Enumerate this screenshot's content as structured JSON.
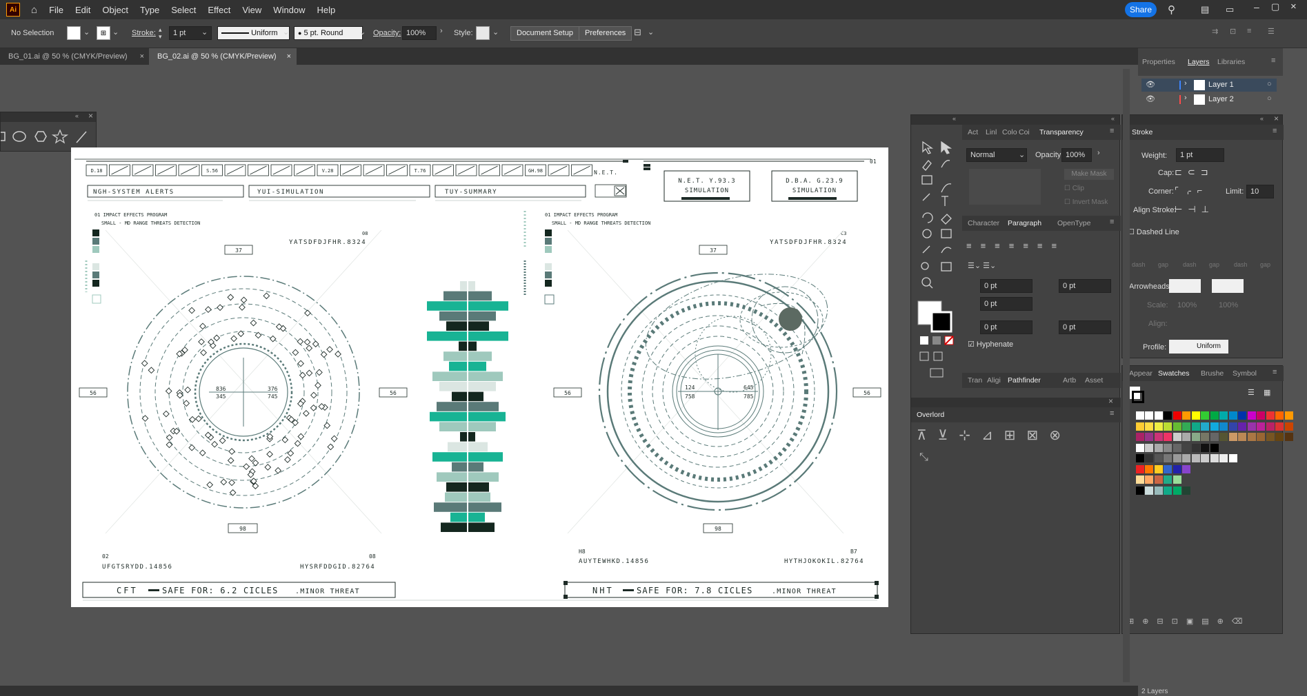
{
  "app": {
    "logo": "Ai"
  },
  "menu": [
    "File",
    "Edit",
    "Object",
    "Type",
    "Select",
    "Effect",
    "View",
    "Window",
    "Help"
  ],
  "share_label": "Share",
  "control": {
    "selection": "No Selection",
    "stroke_label": "Stroke:",
    "stroke_value": "1 pt",
    "uniform": "Uniform",
    "brush": "5 pt. Round",
    "opacity_label": "Opacity:",
    "opacity_value": "100%",
    "style_label": "Style:",
    "doc_setup": "Document Setup",
    "preferences": "Preferences"
  },
  "tabs": [
    {
      "label": "BG_01.ai @ 50 % (CMYK/Preview)",
      "close": "×"
    },
    {
      "label": "BG_02.ai @ 50 % (CMYK/Preview)",
      "close": "×"
    }
  ],
  "layers_panel": {
    "tabs": [
      "Properties",
      "Layers",
      "Libraries"
    ],
    "layers": [
      "Layer 1",
      "Layer 2"
    ],
    "footer": "2 Layers"
  },
  "transparency_panel": {
    "tabs": [
      "Act",
      "Linl",
      "Colo",
      "Coi",
      "Transparency"
    ],
    "mode": "Normal",
    "opacity_label": "Opacity:",
    "opacity_value": "100%",
    "make_mask": "Make Mask",
    "clip": "Clip",
    "invert": "Invert Mask"
  },
  "paragraph_panel": {
    "tabs": [
      "Character",
      "Paragraph",
      "OpenType"
    ],
    "fields": [
      "0 pt",
      "0 pt",
      "0 pt",
      "0 pt",
      "0 pt"
    ],
    "hyphenate": "Hyphenate"
  },
  "pathfinder_row": [
    "Tran",
    "Aligi",
    "Pathfinder",
    "Artb",
    "Asset"
  ],
  "overlord": {
    "title": "Overlord"
  },
  "stroke_panel": {
    "title": "Stroke",
    "weight_label": "Weight:",
    "weight_value": "1 pt",
    "cap_label": "Cap:",
    "corner_label": "Corner:",
    "limit_label": "Limit:",
    "limit_value": "10",
    "align_label": "Align Stroke:",
    "dashed": "Dashed Line",
    "dash_labels": [
      "dash",
      "gap",
      "dash",
      "gap",
      "dash",
      "gap"
    ],
    "arrowheads": "Arrowheads:",
    "scale": "Scale:",
    "scale_values": [
      "100%",
      "100%"
    ],
    "align": "Align:",
    "profile": "Profile:",
    "profile_value": "Uniform"
  },
  "swatches_panel": {
    "tabs": [
      "Appear",
      "Swatches",
      "Brushe",
      "Symbol"
    ]
  },
  "hud": {
    "tick_labels": [
      "D.18",
      "S.56",
      "V.28",
      "T.76",
      "GH.98"
    ],
    "net": "N.E.T.",
    "alerts": [
      "NGH-SYSTEM ALERTS",
      "YUI-SIMULATION",
      "TUY-SUMMARY"
    ],
    "sim_left": [
      "N.E.T.  Y.93.3",
      "SIMULATION"
    ],
    "sim_right": [
      "D.B.A.  G.23.9",
      "SIMULATION"
    ],
    "corner_01": "01",
    "program_left": [
      "01  IMPACT EFFECTS PROGRAM",
      "SMALL - MD RANGE THREATS DETECTION"
    ],
    "program_right": [
      "01  IMPACT EFFECTS PROGRAM",
      "SMALL - MD RANGE THREATS DETECTION"
    ],
    "left_code_top": "YATSDFDJFHR.8324",
    "left_code_top_num": "08",
    "right_code_top": "YATSDFDJFHR.8324",
    "right_code_top_num": "C3",
    "left_marks": [
      "37",
      "56",
      "56",
      "98"
    ],
    "right_marks": [
      "37",
      "56",
      "56",
      "98"
    ],
    "left_inner": [
      "836",
      "345",
      "376",
      "745"
    ],
    "right_inner": [
      "124",
      "758",
      "645",
      "785"
    ],
    "bl_left": [
      "02",
      "UFGTSRYDD.14856"
    ],
    "br_left": [
      "08",
      "HYSRFDDGID.82764"
    ],
    "bl_right": [
      "H8",
      "AUYTEWHKD.14856"
    ],
    "br_right": [
      "B7",
      "HYTHJOKOKIL.82764"
    ],
    "footer_left": [
      "CFT",
      "SAFE FOR: 6.2 CICLES",
      ".MINOR THREAT"
    ],
    "footer_right": [
      "NHT",
      "SAFE FOR: 7.8 CICLES",
      ".MINOR THREAT"
    ]
  },
  "colors": {
    "dark": "#14271f",
    "teal": "#18b394",
    "slate": "#5a7a78",
    "mint": "#9fc9bd",
    "pale": "#dbe6e2"
  }
}
